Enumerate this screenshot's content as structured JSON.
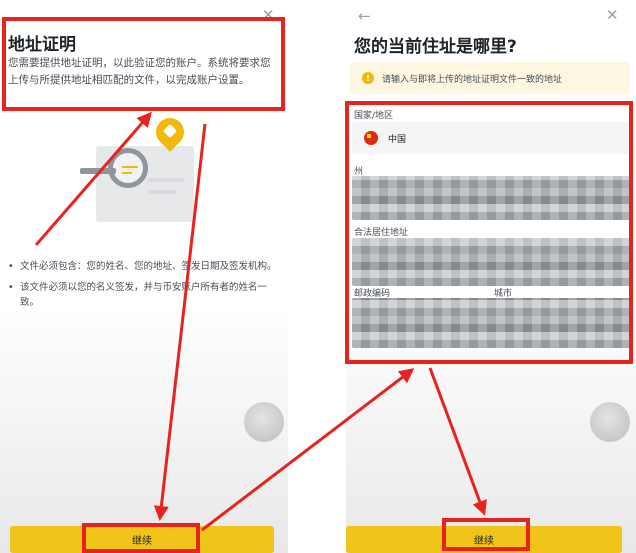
{
  "colors": {
    "brand_yellow": "#f0c419",
    "annotation_red": "#e8231f",
    "notice_bg": "#fdf7e1"
  },
  "left": {
    "title": "地址证明",
    "description": "您需要提供地址证明，以此验证您的账户。系统将要求您上传与所提供地址相匹配的文件，以完成账户设置。",
    "close_icon": "close-icon",
    "illustration": "document-magnifier-illustration",
    "bullets": [
      "文件必须包含：您的姓名、您的地址、签发日期及签发机构。",
      "该文件必须以您的名义签发，并与币安账户所有者的姓名一致。"
    ],
    "continue_label": "继续"
  },
  "right": {
    "back_icon": "back-arrow-icon",
    "close_icon": "close-icon",
    "title": "您的当前住址是哪里?",
    "notice": "请输入与即将上传的地址证明文件一致的地址",
    "country_label": "国家/地区",
    "country_value": "中国",
    "state_label": "州",
    "address_label": "合法居住地址",
    "postal_label": "邮政编码",
    "city_label": "城市",
    "continue_label": "继续"
  }
}
